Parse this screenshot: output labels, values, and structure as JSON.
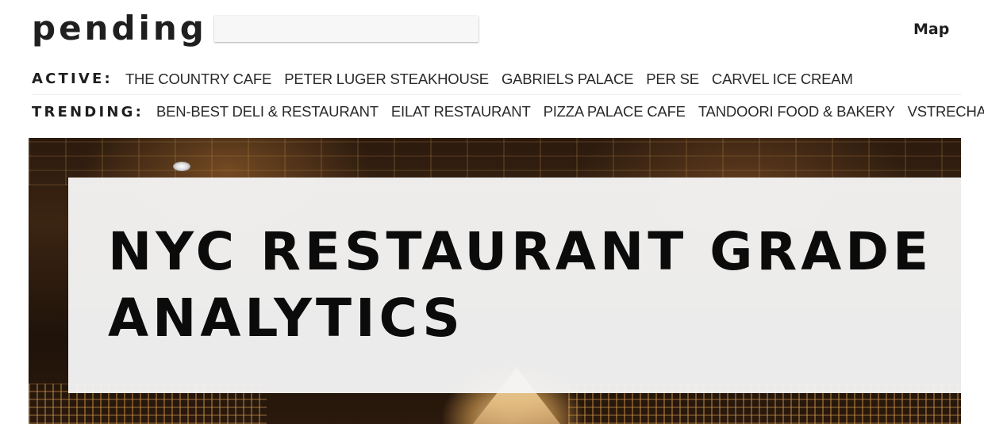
{
  "header": {
    "logo": "pending",
    "search_placeholder": "",
    "search_value": "",
    "map_label": "Map"
  },
  "active": {
    "label": "ACTIVE:",
    "items": [
      "THE COUNTRY CAFE",
      "PETER LUGER STEAKHOUSE",
      "GABRIELS PALACE",
      "PER SE",
      "CARVEL ICE CREAM"
    ]
  },
  "trending": {
    "label": "TRENDING:",
    "items": [
      "BEN-BEST DELI & RESTAURANT",
      "EILAT RESTAURANT",
      "PIZZA PALACE CAFE",
      "TANDOORI FOOD & BAKERY",
      "VSTRECHA"
    ]
  },
  "hero": {
    "title": "NYC RESTAURANT GRADE ANALYTICS"
  }
}
